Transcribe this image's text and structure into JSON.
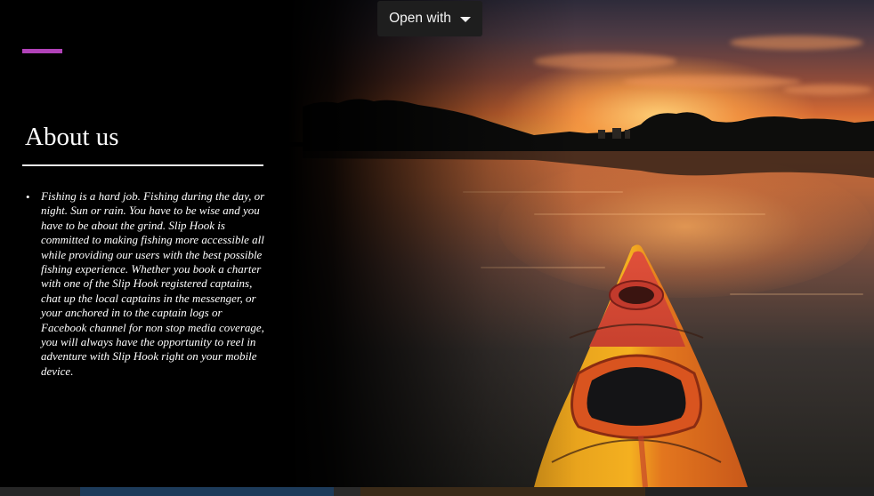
{
  "toolbar": {
    "open_with_label": "Open with",
    "open_with_icon": "caret-down-icon"
  },
  "slide": {
    "accent_color": "#b142b8",
    "heading": "About us",
    "bullet_char": "•",
    "body": "Fishing is a hard job. Fishing during the day, or night. Sun or rain. You have to be wise and you have to be about the grind. Slip Hook is committed to making fishing more accessible all while providing our users with the best possible fishing experience. Whether you book a charter with one of the Slip Hook registered captains, chat up the local captains in the messenger, or your anchored in to the captain logs or Facebook channel for non stop media coverage, you will always have the opportunity to reel in adventure with Slip Hook right on your mobile device.",
    "background_image": "sunset-lake-kayak-photo"
  }
}
